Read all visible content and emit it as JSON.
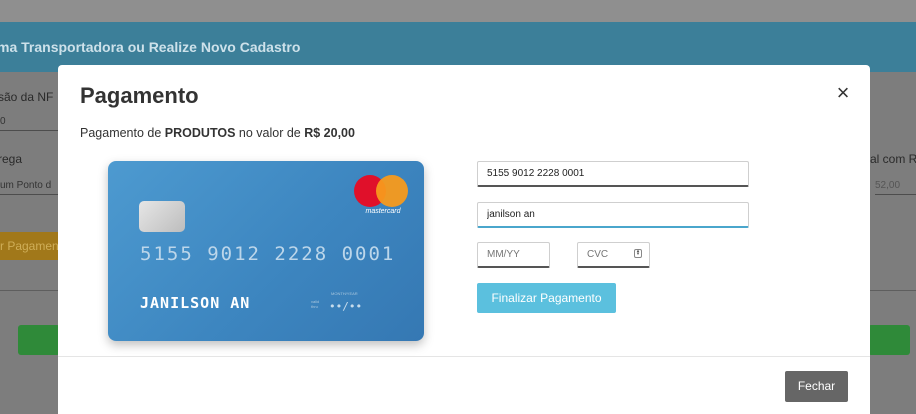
{
  "background": {
    "header_title": "ma Transportadora ou Realize Novo Cadastro",
    "label_nf": "são da NF",
    "value_nf": "0",
    "label_entrega": "rega",
    "value_entrega": "um Ponto d",
    "yellow_button": "r Pagamen",
    "label_right": "al com R",
    "value_right": "52,00"
  },
  "modal": {
    "title": "Pagamento",
    "close_icon": "×",
    "description_prefix": "Pagamento de ",
    "description_item": "PRODUTOS",
    "description_middle": " no valor de ",
    "description_amount": "R$ 20,00",
    "card": {
      "number": "5155 9012 2228 0001",
      "name": "JANILSON AN",
      "expiry": "••/••",
      "brand": "mastercard",
      "valid_thru_label": "valid thru",
      "month_year_label": "MONTH/YEAR"
    },
    "form": {
      "card_number_value": "5155 9012 2228 0001",
      "name_value": "janilson an",
      "expiry_placeholder": "MM/YY",
      "cvc_placeholder": "CVC",
      "submit_label": "Finalizar Pagamento"
    },
    "footer": {
      "close_label": "Fechar"
    }
  },
  "colors": {
    "card_blue": "#3d86c0",
    "pay_button": "#5bc0de",
    "close_button": "#666666",
    "bg_header": "#3c7f99"
  }
}
